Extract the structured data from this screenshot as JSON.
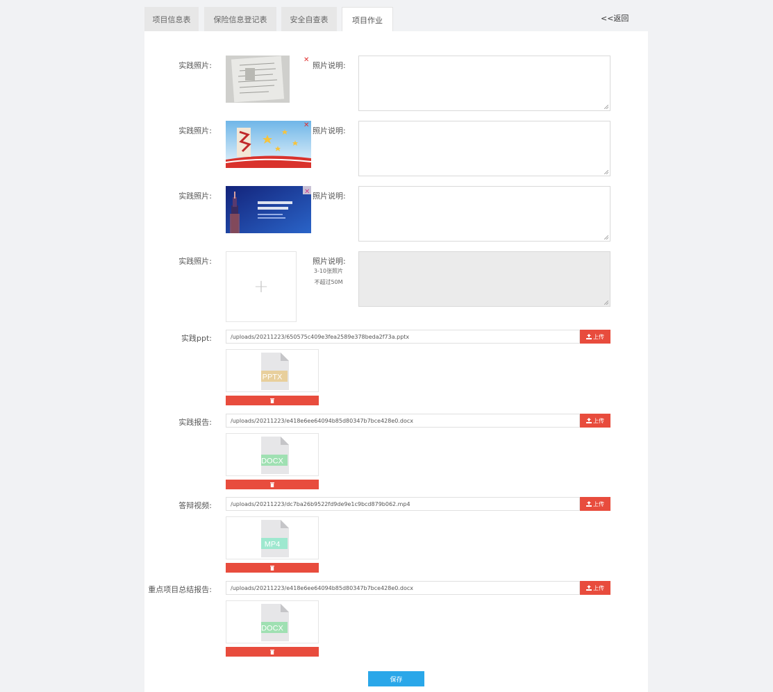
{
  "tabs": [
    {
      "label": "项目信息表"
    },
    {
      "label": "保险信息登记表"
    },
    {
      "label": "安全自查表"
    },
    {
      "label": "项目作业"
    }
  ],
  "back_link": "<<返回",
  "photos": [
    {
      "label": "实践照片:",
      "desc_label": "照片说明:",
      "desc_value": ""
    },
    {
      "label": "实践照片:",
      "desc_label": "照片说明:",
      "desc_value": ""
    },
    {
      "label": "实践照片:",
      "desc_label": "照片说明:",
      "desc_value": ""
    }
  ],
  "new_photo": {
    "label": "实践照片:",
    "desc_label": "照片说明:",
    "hint_line1": "3-10张照片",
    "hint_line2": "不超过50M",
    "plus": "+"
  },
  "files": [
    {
      "label": "实践ppt:",
      "path": "/uploads/20211223/650575c409e3fea2589e378beda2f73a.pptx",
      "ext": "PPTX",
      "ext_color": "#e8cf9c"
    },
    {
      "label": "实践报告:",
      "path": "/uploads/20211223/e418e6ee64094b85d80347b7bce428e0.docx",
      "ext": "DOCX",
      "ext_color": "#9fe0b2"
    },
    {
      "label": "答辩视频:",
      "path": "/uploads/20211223/dc7ba26b9522fd9de9e1c9bcd879b062.mp4",
      "ext": "MP4",
      "ext_color": "#9ee8cf"
    },
    {
      "label": "重点项目总结报告:",
      "path": "/uploads/20211223/e418e6ee64094b85d80347b7bce428e0.docx",
      "ext": "DOCX",
      "ext_color": "#9fe0b2"
    }
  ],
  "upload_label": "上传",
  "save_label": "保存",
  "colors": {
    "accent_red": "#e84c3d",
    "accent_blue": "#2aa7e9"
  }
}
